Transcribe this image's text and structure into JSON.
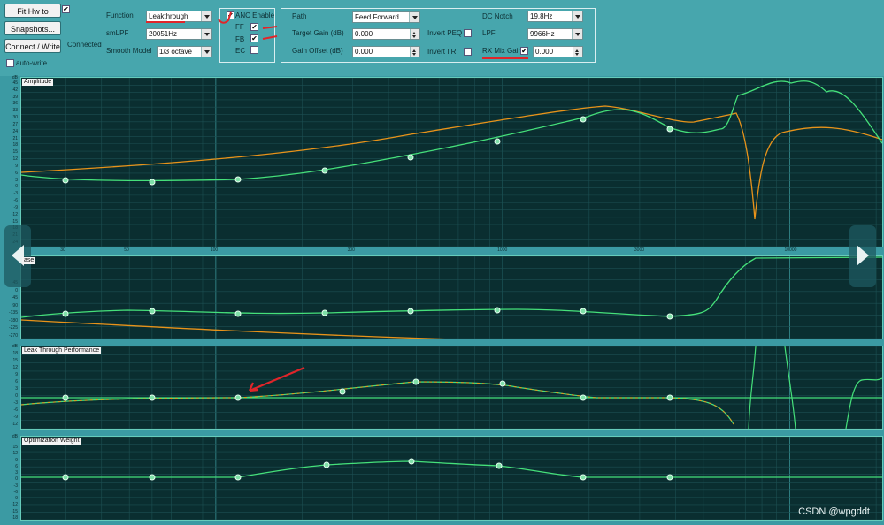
{
  "controls": {
    "fit_btn": "Fit Hw to Target",
    "fit_checked": "✔",
    "snapshots_btn": "Snapshots...",
    "connect_btn": "Connect / Write",
    "connected_label": "Connected",
    "autowrite_label": "auto-write",
    "function_label": "Function",
    "function_value": "Leakthrough",
    "smlpf_label": "smLPF",
    "smlpf_value": "20051Hz",
    "smooth_label": "Smooth Model",
    "smooth_value": "1/3 octave",
    "anc_label": "ANC Enable",
    "ff_label": "FF",
    "fb_label": "FB",
    "ec_label": "EC",
    "checked_mark": "✔",
    "path_label": "Path",
    "path_value": "Feed Forward",
    "target_gain_label": "Target Gain (dB)",
    "target_gain_value": "0.000",
    "gain_offset_label": "Gain Offset (dB)",
    "gain_offset_value": "0.000",
    "invert_peq_label": "Invert PEQ",
    "invert_iir_label": "Invert IIR",
    "dc_notch_label": "DC Notch",
    "dc_notch_value": "19.8Hz",
    "lpf_label": "LPF",
    "lpf_value": "9966Hz",
    "rx_mix_label": "RX Mix Gain",
    "rx_mix_value": "0.000"
  },
  "panels": {
    "amplitude_title": "Amplitude",
    "phase_title": "ase",
    "leak_title": "Leak Through Performance",
    "weight_title": "Optimization Weight",
    "db_unit": "dB"
  },
  "amp_yticks": [
    "45",
    "42",
    "39",
    "36",
    "33",
    "30",
    "27",
    "24",
    "21",
    "18",
    "15",
    "12",
    "9",
    "6",
    "3",
    "0",
    "-3",
    "-6",
    "-9",
    "-12",
    "-15",
    "-18",
    "-21",
    "-24"
  ],
  "phase_yticks": [
    "45",
    "0",
    "-45",
    "-90",
    "-135",
    "-180",
    "-225",
    "-270"
  ],
  "leak_yticks": [
    "18",
    "15",
    "12",
    "9",
    "6",
    "3",
    "0",
    "-3",
    "-6",
    "-9",
    "-12"
  ],
  "weight_yticks": [
    "15",
    "12",
    "9",
    "6",
    "3",
    "0",
    "-3",
    "-6",
    "-9",
    "-12",
    "-15",
    "-18"
  ],
  "xticks": [
    "30",
    "50",
    "100",
    "300",
    "1000",
    "3000",
    "10000"
  ],
  "watermark": "CSDN @wpgddt",
  "colors": {
    "measured": "#45e07a",
    "target": "#e8931a",
    "annotation": "#e0252a",
    "grid": "#1f5a5d"
  }
}
